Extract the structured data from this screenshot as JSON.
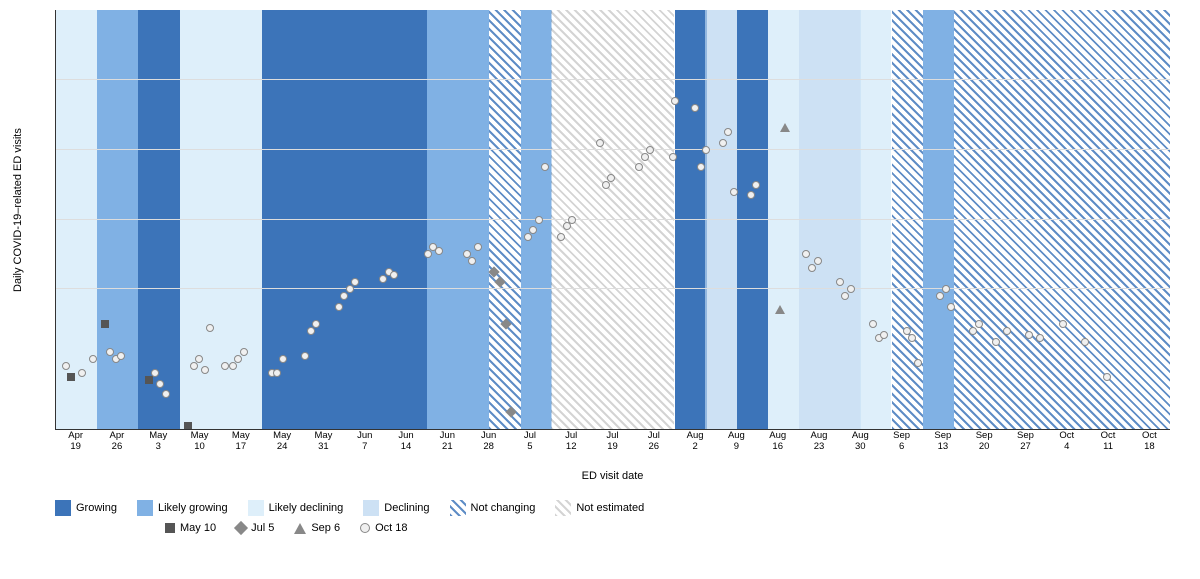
{
  "chart": {
    "y_axis_label": "Daily COVID-19–related ED visits",
    "x_axis_label": "ED visit date",
    "title": "Daily COVID-19–related ED visits",
    "y_ticks": [
      0,
      20,
      40,
      60,
      80,
      100,
      120
    ],
    "x_labels": [
      {
        "text": "Apr\n19",
        "line1": "Apr",
        "line2": "19"
      },
      {
        "text": "Apr\n26",
        "line1": "Apr",
        "line2": "26"
      },
      {
        "text": "May\n3",
        "line1": "May",
        "line2": "3"
      },
      {
        "text": "May\n10",
        "line1": "May",
        "line2": "10"
      },
      {
        "text": "May\n17",
        "line1": "May",
        "line2": "17"
      },
      {
        "text": "May\n24",
        "line1": "May",
        "line2": "24"
      },
      {
        "text": "May\n31",
        "line1": "May",
        "line2": "31"
      },
      {
        "text": "Jun\n7",
        "line1": "Jun",
        "line2": "7"
      },
      {
        "text": "Jun\n14",
        "line1": "Jun",
        "line2": "14"
      },
      {
        "text": "Jun\n21",
        "line1": "Jun",
        "line2": "21"
      },
      {
        "text": "Jun\n28",
        "line1": "Jun",
        "line2": "28"
      },
      {
        "text": "Jul\n5",
        "line1": "Jul",
        "line2": "5"
      },
      {
        "text": "Jul\n12",
        "line1": "Jul",
        "line2": "12"
      },
      {
        "text": "Jul\n19",
        "line1": "Jul",
        "line2": "19"
      },
      {
        "text": "Jul\n26",
        "line1": "Jul",
        "line2": "26"
      },
      {
        "text": "Aug\n2",
        "line1": "Aug",
        "line2": "2"
      },
      {
        "text": "Aug\n9",
        "line1": "Aug",
        "line2": "9"
      },
      {
        "text": "Aug\n16",
        "line1": "Aug",
        "line2": "16"
      },
      {
        "text": "Aug\n23",
        "line1": "Aug",
        "line2": "23"
      },
      {
        "text": "Aug\n30",
        "line1": "Aug",
        "line2": "30"
      },
      {
        "text": "Sep\n6",
        "line1": "Sep",
        "line2": "6"
      },
      {
        "text": "Sep\n13",
        "line1": "Sep",
        "line2": "13"
      },
      {
        "text": "Sep\n20",
        "line1": "Sep",
        "line2": "20"
      },
      {
        "text": "Sep\n27",
        "line1": "Sep",
        "line2": "27"
      },
      {
        "text": "Oct\n4",
        "line1": "Oct",
        "line2": "4"
      },
      {
        "text": "Oct\n11",
        "line1": "Oct",
        "line2": "11"
      },
      {
        "text": "Oct\n18",
        "line1": "Oct",
        "line2": "18"
      }
    ]
  },
  "legend": {
    "row1": [
      {
        "label": "Growing",
        "type": "solid-dark-blue"
      },
      {
        "label": "Likely growing",
        "type": "solid-mid-blue"
      },
      {
        "label": "Likely declining",
        "type": "solid-pale-blue"
      },
      {
        "label": "Declining",
        "type": "solid-light-blue"
      },
      {
        "label": "Not changing",
        "type": "hatch-blue"
      },
      {
        "label": "Not estimated",
        "type": "hatch-gray"
      }
    ],
    "row2": [
      {
        "label": "May 10",
        "type": "square"
      },
      {
        "label": "Jul 5",
        "type": "diamond"
      },
      {
        "label": "Sep 6",
        "type": "triangle"
      },
      {
        "label": "Oct 18",
        "type": "circle"
      }
    ]
  },
  "annotations": {
    "likely_declining": "Likely declining",
    "likely_declining_date": "Oct 18",
    "not_estimated": "Not estimated",
    "declining": "Declining"
  }
}
